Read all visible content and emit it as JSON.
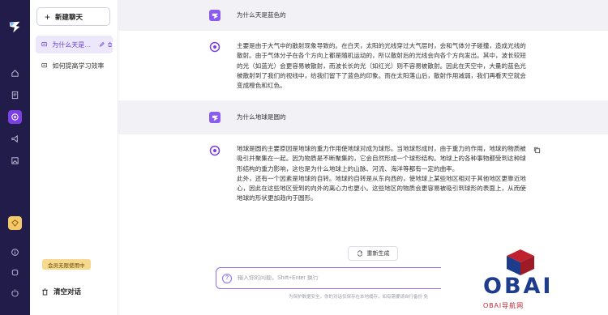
{
  "sidebar": {
    "new_chat_label": "新建聊天",
    "conversations": [
      {
        "title": "为什么天是蓝色的",
        "active": true
      },
      {
        "title": "如何提高学习效率",
        "active": false
      }
    ],
    "vip_badge": "会员无限使用中",
    "clear_label": "清空对话"
  },
  "chat": {
    "messages": [
      {
        "role": "user",
        "text": "为什么天是蓝色的"
      },
      {
        "role": "assistant",
        "paragraphs": [
          "主要是由于大气中的散射现象导致的。在白天，太阳的光线穿过大气层时，会和气体分子碰撞，造成光线的散射。由于气体分子在各个方向上都是随机运动的，所以散射后的光线会向各个方向发出。其中，波长较短的光（如蓝光）会更容易被散射，而波长长的光（如红光）则不容易被散射。因此在天空中，大量的蓝色光被散射到了我们的视线中，给我们留下了蓝色的印象。而在太阳落山后，散射作用减弱，我们再看天空就会变成橙色和红色。"
        ]
      },
      {
        "role": "user",
        "text": "为什么地球是圆的"
      },
      {
        "role": "assistant",
        "paragraphs": [
          "地球是圆的主要原因是地球的重力作用使地球对成为球形。当地球形成时，由于重力的作用，地球的物质被吸引并聚集在一起。因为物质是不断聚集的，它会自然形成一个球形结构。地球上的各种事物都受到这种球形结构的重力影响，这也是为什么地球上的山脉、河流、海洋等都有一定的曲率。",
          "此外，还有一个因素是地球的自转。地球的自转是从东向西的，使地球上某些地区相对于其他地区更靠近地心，因此在这些地区受到的向外的离心力也更小。这些地区的物质会更容易被吸引到球形的表面上，从而使地球的形状更加趋向于圆形。"
        ]
      }
    ],
    "regenerate_label": "重新生成",
    "input_placeholder": "输入你的问题，Shift+Enter 换行",
    "footer_note": "为保护数据安全，你的对话仅保存在本地缓存，如有需要请自行备份 免"
  },
  "watermark": {
    "brand": "OBAI",
    "subtitle": "OBAI导航网"
  },
  "colors": {
    "rail_bg": "#221c4a",
    "accent": "#7b3fe4",
    "vip": "#f3c96a"
  }
}
